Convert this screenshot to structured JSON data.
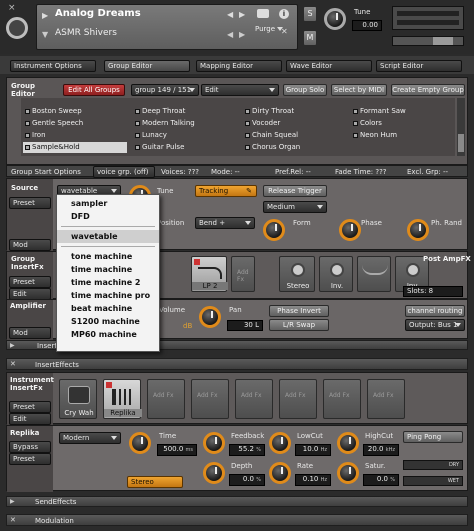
{
  "header": {
    "instrument_name": "Analog Dreams",
    "snapshot_name": "ASMR Shivers",
    "purge_label": "Purge",
    "s_label": "S",
    "m_label": "M",
    "tune_label": "Tune",
    "tune_value": "0.00"
  },
  "editor_tabs": [
    {
      "label": "Instrument Options"
    },
    {
      "label": "Group Editor"
    },
    {
      "label": "Mapping Editor"
    },
    {
      "label": "Wave Editor"
    },
    {
      "label": "Script Editor"
    }
  ],
  "group_editor": {
    "title_line1": "Group",
    "title_line2": "Editor",
    "edit_all_groups": "Edit All Groups",
    "group_selector": "group 149 / 151",
    "edit_menu": "Edit",
    "group_solo": "Group Solo",
    "select_by_midi": "Select by MIDI",
    "create_empty_group": "Create Empty Group",
    "groups": [
      [
        "Boston Sweep",
        "Deep Throat",
        "Dirty Throat",
        "Formant Saw"
      ],
      [
        "Gentle Speech",
        "Modern Talking",
        "Vocoder",
        "Colors"
      ],
      [
        "Iron",
        "Lunacy",
        "Chain Squeal",
        "Neon Hum"
      ],
      [
        "Sample&Hold",
        "Guitar Pulse",
        "Chorus Organ",
        ""
      ]
    ]
  },
  "group_start_options": {
    "label": "Group Start Options",
    "voice_grp": "voice grp. (off)",
    "voices": "Voices: ???",
    "mode": "Mode: --",
    "prel_rel": "Pref.Rel: --",
    "fade_time": "Fade Time: ???",
    "excl_grp": "Excl. Grp: --"
  },
  "source": {
    "label": "Source",
    "preset": "Preset",
    "mode_selected": "wavetable",
    "tune": "Tune",
    "position": "Position",
    "tracking": "Tracking",
    "release_trigger": "Release Trigger",
    "medium": "Medium",
    "bend": "Bend +",
    "form": "Form",
    "phase": "Phase",
    "ph_rand": "Ph. Rand",
    "mod": "Mod"
  },
  "dropdown": {
    "items_top": [
      "sampler",
      "DFD"
    ],
    "selected": "wavetable",
    "items_bottom": [
      "tone machine",
      "time machine",
      "time machine 2",
      "time machine pro",
      "beat machine",
      "S1200 machine",
      "MP60 machine"
    ]
  },
  "group_insert": {
    "label1": "Group",
    "label2": "InsertFx",
    "preset": "Preset",
    "edit": "Edit",
    "slots": [
      "LP 2",
      "Add Fx",
      "",
      "Stereo",
      "Inv.",
      "",
      "Inv."
    ],
    "post_ampfx": "Post AmpFX",
    "slots_label": "Slots: 8"
  },
  "amplifier": {
    "label": "Amplifier",
    "volume": "Volume",
    "db": "dB",
    "pan": "Pan",
    "pan_value": "30 L",
    "phase_invert": "Phase Invert",
    "lr_swap": "L/R Swap",
    "channel_routing": "channel routing",
    "output": "Output: Bus 1",
    "mod": "Mod"
  },
  "sections": {
    "insert_collapsed": "Insert",
    "insert_effects": "InsertEffects",
    "send_effects": "SendEffects",
    "modulation": "Modulation"
  },
  "instrument_insert": {
    "label1": "Instrument",
    "label2": "InsertFx",
    "preset": "Preset",
    "edit": "Edit",
    "slots": [
      "Cry Wah",
      "Replika",
      "Add Fx",
      "Add Fx",
      "Add Fx",
      "Add Fx",
      "Add Fx",
      "Add Fx"
    ]
  },
  "replika": {
    "label": "Replika",
    "bypass": "Bypass",
    "preset": "Preset",
    "mode": "Modern",
    "time_label": "Time",
    "time_value": "500.0",
    "time_unit": "ms",
    "feedback_label": "Feedback",
    "feedback_value": "55.2",
    "feedback_unit": "%",
    "lowcut_label": "LowCut",
    "lowcut_value": "10.0",
    "lowcut_unit": "Hz",
    "highcut_label": "HighCut",
    "highcut_value": "20.0",
    "highcut_unit": "kHz",
    "ping_pong": "Ping Pong",
    "stereo": "Stereo",
    "depth_label": "Depth",
    "depth_value": "0.0",
    "depth_unit": "%",
    "rate_label": "Rate",
    "rate_value": "0.10",
    "rate_unit": "Hz",
    "satur_label": "Satur.",
    "satur_value": "0.0",
    "satur_unit": "%",
    "dry": "DRY",
    "wet": "WET"
  },
  "colors": {
    "accent_orange": "#e08b1a",
    "selected_red": "#b33030",
    "panel_gray": "#8e8a86"
  }
}
